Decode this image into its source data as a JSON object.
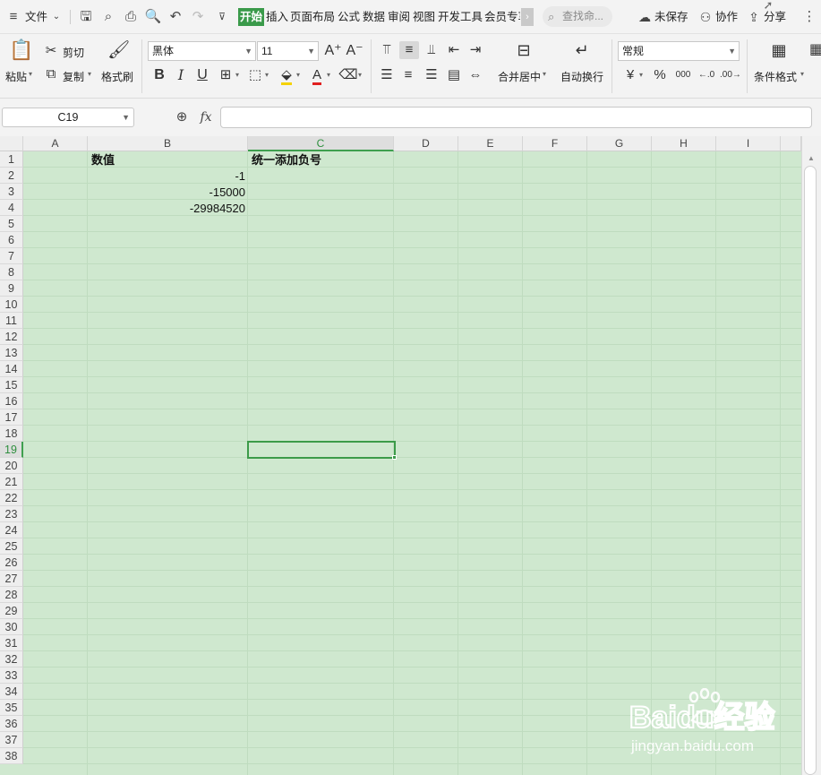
{
  "menubar": {
    "file_label": "文件",
    "tabs": [
      "开始",
      "插入",
      "页面布局",
      "公式",
      "数据",
      "审阅",
      "视图",
      "开发工具",
      "会员专享"
    ],
    "active_tab": "开始",
    "search_placeholder": "查找命...",
    "unsaved_label": "未保存",
    "collab_label": "协作",
    "share_label": "分享"
  },
  "ribbon": {
    "paste_label": "粘贴",
    "cut_label": "剪切",
    "copy_label": "复制",
    "format_painter_label": "格式刷",
    "font_name": "黑体",
    "font_size": "11",
    "bold": "B",
    "italic": "I",
    "underline": "U",
    "merge_center_label": "合并居中",
    "wrap_text_label": "自动换行",
    "number_format": "常规",
    "currency_symbol": "¥",
    "percent_symbol": "%",
    "thousands_symbol": "000",
    "conditional_format_label": "条件格式"
  },
  "formula_bar": {
    "name_box": "C19",
    "fx_label": "fx",
    "formula": ""
  },
  "sheet": {
    "columns": [
      "A",
      "B",
      "C",
      "D",
      "E",
      "F",
      "G",
      "H",
      "I"
    ],
    "selected_column": "C",
    "rows": [
      "1",
      "2",
      "3",
      "4",
      "5",
      "6",
      "7",
      "8",
      "9",
      "10",
      "11",
      "12",
      "13",
      "14",
      "15",
      "16",
      "17",
      "18",
      "19",
      "20",
      "21",
      "22",
      "23",
      "24",
      "25",
      "26",
      "27",
      "28",
      "29",
      "30",
      "31",
      "32",
      "33",
      "34",
      "35",
      "36",
      "37",
      "38"
    ],
    "selected_row": "19",
    "cells": {
      "B1": "数值",
      "B2": "-1",
      "B3": "-15000",
      "B4": "-29984520",
      "C1": "统一添加负号"
    }
  },
  "watermark": {
    "brand": "Baidu经验",
    "url": "jingyan.baidu.com"
  },
  "colors": {
    "accent_green": "#3a9a4a",
    "sheet_background": "#cfe8cf"
  }
}
